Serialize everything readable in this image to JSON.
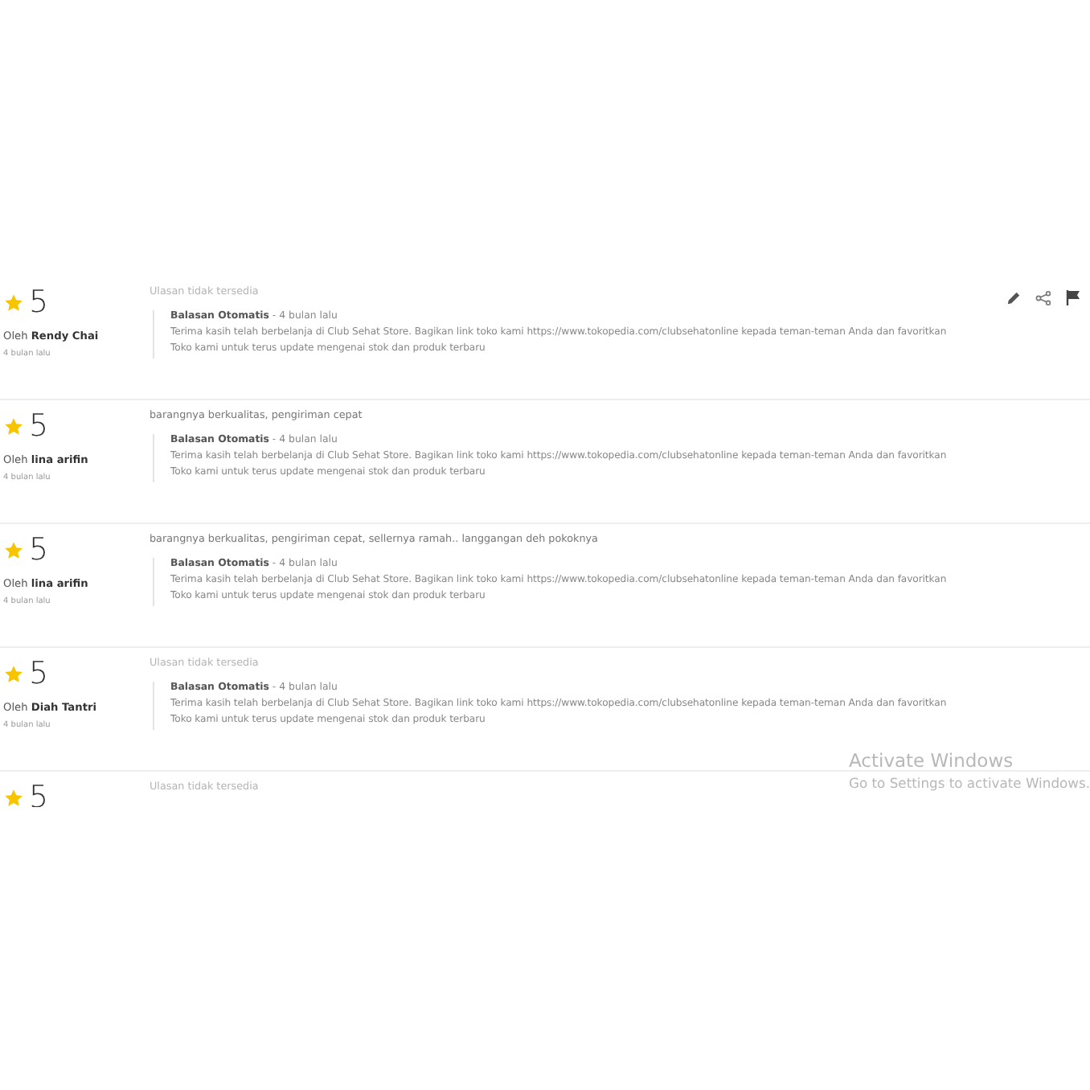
{
  "reviews": [
    {
      "kind": "no_text",
      "rating": "5",
      "author": "Oleh **Rendy Chai**",
      "time": "4 bulan lalu",
      "text": "Ulasan tidak tersedia",
      "actions": true,
      "reply": {
        "header": "**Balasan Otomatis** - 4 bulan lalu",
        "lines": [
          "Terima kasih telah berbelanja di Club Sehat Store. Bagikan link toko kami https://www.tokopedia.com/clubsehatonline kepada teman-teman Anda dan favoritkan",
          "Toko kami untuk terus update mengenai stok dan produk terbaru"
        ]
      }
    },
    {
      "kind": "text",
      "rating": "5",
      "author": "Oleh **lina arifin**",
      "time": "4 bulan lalu",
      "text": "barangnya berkualitas, pengiriman cepat",
      "actions": false,
      "reply": {
        "header": "**Balasan Otomatis** - 4 bulan lalu",
        "lines": [
          "Terima kasih telah berbelanja di Club Sehat Store. Bagikan link toko kami https://www.tokopedia.com/clubsehatonline kepada teman-teman Anda dan favoritkan",
          "Toko kami untuk terus update mengenai stok dan produk terbaru"
        ]
      }
    },
    {
      "kind": "text",
      "rating": "5",
      "author": "Oleh **lina arifin**",
      "time": "4 bulan lalu",
      "text": "barangnya berkualitas, pengiriman cepat, sellernya ramah.. langgangan deh pokoknya",
      "actions": false,
      "reply": {
        "header": "**Balasan Otomatis** - 4 bulan lalu",
        "lines": [
          "Terima kasih telah berbelanja di Club Sehat Store. Bagikan link toko kami https://www.tokopedia.com/clubsehatonline kepada teman-teman Anda dan favoritkan",
          "Toko kami untuk terus update mengenai stok dan produk terbaru"
        ]
      }
    },
    {
      "kind": "no_text",
      "rating": "5",
      "author": "Oleh **Diah Tantri**",
      "time": "4 bulan lalu",
      "text": "Ulasan tidak tersedia",
      "actions": false,
      "reply": {
        "header": "**Balasan Otomatis** - 4 bulan lalu",
        "lines": [
          "Terima kasih telah berbelanja di Club Sehat Store. Bagikan link toko kami https://www.tokopedia.com/clubsehatonline kepada teman-teman Anda dan favoritkan",
          "Toko kami untuk terus update mengenai stok dan produk terbaru"
        ]
      }
    },
    {
      "kind": "no_text",
      "rating": "5",
      "text": "Ulasan tidak tersedia",
      "actions": false
    }
  ],
  "os_notice": {
    "title": "Activate Windows",
    "subtitle": "Go to Settings to activate Windows."
  }
}
